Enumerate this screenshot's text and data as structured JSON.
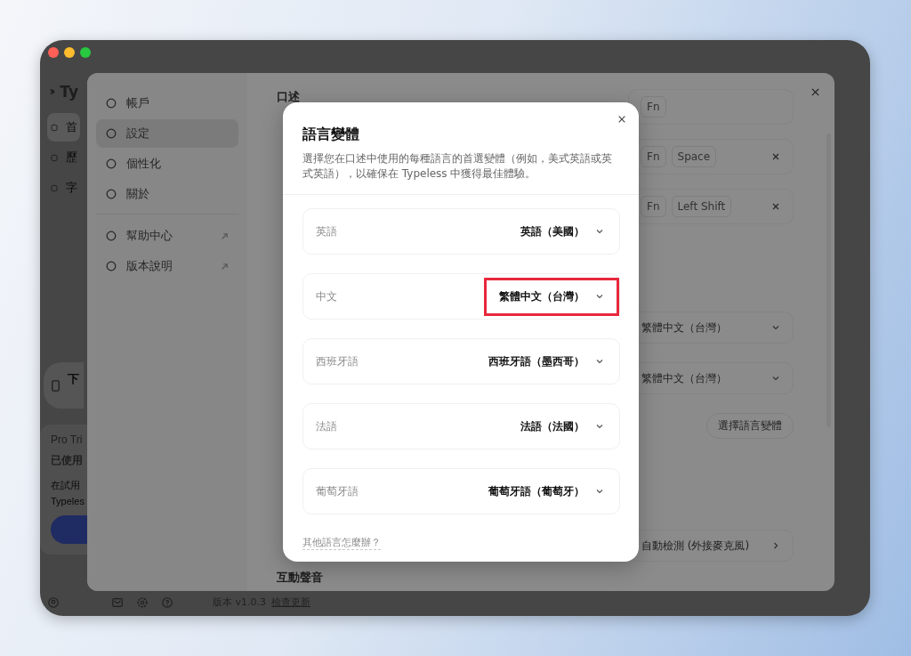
{
  "app_sidebar": {
    "logo": "Ty",
    "items": [
      {
        "label": "首",
        "selected": true
      },
      {
        "label": "歷",
        "selected": false
      },
      {
        "label": "字",
        "selected": false
      }
    ],
    "download_card": "下",
    "trial": {
      "title": "Pro Tri",
      "usage": "已使用",
      "text_lines": [
        "在試用",
        "Typeles"
      ]
    },
    "footer": {
      "version": "版本 v1.0.3",
      "update_link": "檢查更新"
    }
  },
  "settings": {
    "nav_groups": [
      [
        {
          "label": "帳戶",
          "selected": false,
          "external": false
        },
        {
          "label": "設定",
          "selected": true,
          "external": false
        },
        {
          "label": "個性化",
          "selected": false,
          "external": false
        },
        {
          "label": "關於",
          "selected": false,
          "external": false
        }
      ],
      [
        {
          "label": "幫助中心",
          "selected": false,
          "external": true
        },
        {
          "label": "版本說明",
          "selected": false,
          "external": true
        }
      ]
    ],
    "dictation_label": "口述",
    "shortcuts": [
      {
        "keys": [
          "Fn"
        ],
        "removable": false
      },
      {
        "keys": [
          "Fn",
          "Space"
        ],
        "removable": true
      },
      {
        "keys": [
          "Fn",
          "Left Shift"
        ],
        "removable": true
      }
    ],
    "dropdowns": [
      "繁體中文（台灣）",
      "繁體中文（台灣）"
    ],
    "variant_button": "選擇語言變體",
    "mic_button": "自動檢測 (外接麥克風)",
    "sound_label": "互動聲音"
  },
  "modal": {
    "title": "語言變體",
    "description": "選擇您在口述中使用的每種語言的首選變體（例如，美式英語或英式英語），以確保在 Typeless 中獲得最佳體驗。",
    "rows": [
      {
        "language": "英語",
        "variant": "英語（美國）",
        "highlighted": false
      },
      {
        "language": "中文",
        "variant": "繁體中文（台灣）",
        "highlighted": true
      },
      {
        "language": "西班牙語",
        "variant": "西班牙語（墨西哥）",
        "highlighted": false
      },
      {
        "language": "法語",
        "variant": "法語（法國）",
        "highlighted": false
      },
      {
        "language": "葡萄牙語",
        "variant": "葡萄牙語（葡萄牙）",
        "highlighted": false
      }
    ],
    "footer_link": "其他語言怎麼辦？"
  }
}
